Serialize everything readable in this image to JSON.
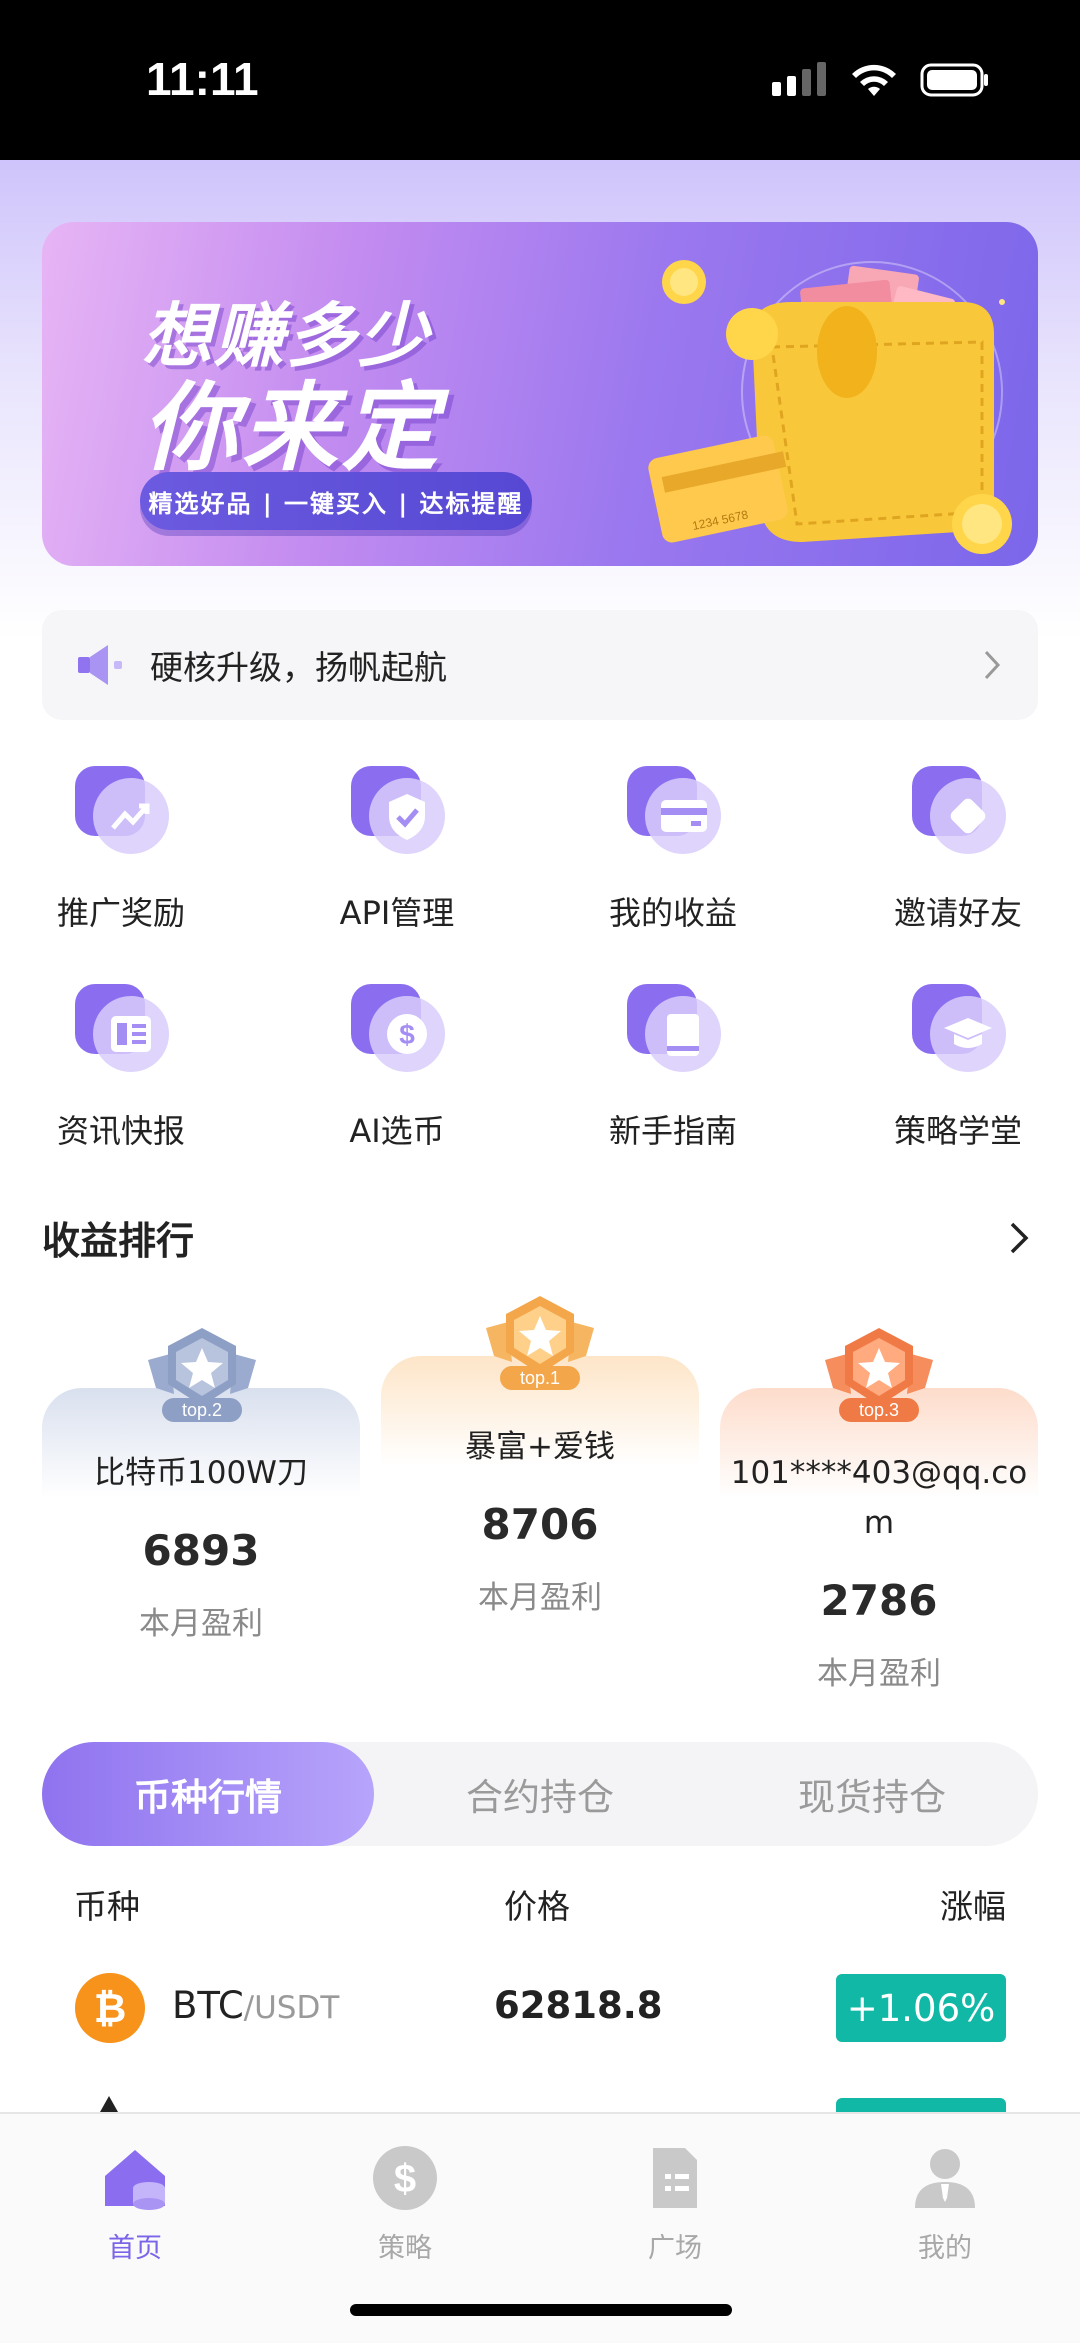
{
  "status_bar": {
    "time": "11:11"
  },
  "banner": {
    "line1": "想赚多少",
    "line2": "你来定",
    "pill": "精选好品 | 一键买入 | 达标提醒",
    "card_number": "1234 5678"
  },
  "notice": {
    "text": "硬核升级，扬帆起航"
  },
  "menu": [
    {
      "label": "推广奖励",
      "icon": "chart-up-icon"
    },
    {
      "label": "API管理",
      "icon": "shield-check-icon"
    },
    {
      "label": "我的收益",
      "icon": "card-icon"
    },
    {
      "label": "邀请好友",
      "icon": "diamond-icon"
    },
    {
      "label": "资讯快报",
      "icon": "news-icon"
    },
    {
      "label": "AI选币",
      "icon": "dollar-coin-icon"
    },
    {
      "label": "新手指南",
      "icon": "book-icon"
    },
    {
      "label": "策略学堂",
      "icon": "graduation-cap-icon"
    }
  ],
  "ranking": {
    "title": "收益排行",
    "entries": [
      {
        "badge": "top.2",
        "name": "比特币100W刀",
        "value": "6893",
        "sub": "本月盈利"
      },
      {
        "badge": "top.1",
        "name": "暴富+爱钱",
        "value": "8706",
        "sub": "本月盈利"
      },
      {
        "badge": "top.3",
        "name": "101****403@qq.co",
        "name2": "m",
        "value": "2786",
        "sub": "本月盈利"
      }
    ],
    "colors": {
      "silver": "#8d9fc4",
      "gold": "#f3a64a",
      "bronze": "#f07a45"
    }
  },
  "tabs": [
    {
      "label": "币种行情",
      "active": true
    },
    {
      "label": "合约持仓",
      "active": false
    },
    {
      "label": "现货持仓",
      "active": false
    }
  ],
  "market": {
    "headers": {
      "coin": "币种",
      "price": "价格",
      "change": "涨幅"
    },
    "rows": [
      {
        "symbol": "BTC",
        "pair": "/USDT",
        "price": "62818.8",
        "change": "+1.06%"
      }
    ],
    "up_color": "#11b8a6"
  },
  "bottom_nav": [
    {
      "label": "首页",
      "icon": "home-icon",
      "active": true
    },
    {
      "label": "策略",
      "icon": "dollar-circle-icon",
      "active": false
    },
    {
      "label": "广场",
      "icon": "document-icon",
      "active": false
    },
    {
      "label": "我的",
      "icon": "user-icon",
      "active": false
    }
  ],
  "accent_color": "#7b64e8"
}
